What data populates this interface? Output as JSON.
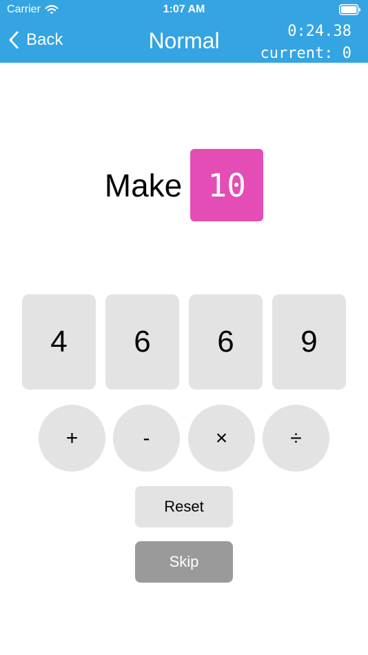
{
  "status_bar": {
    "carrier": "Carrier",
    "time": "1:07 AM"
  },
  "nav": {
    "back_label": "Back",
    "title": "Normal",
    "timer": "0:24.38",
    "current": "current: 0"
  },
  "game": {
    "make_label": "Make",
    "target": "10",
    "cards": [
      "4",
      "6",
      "6",
      "9"
    ],
    "operators": [
      "+",
      "-",
      "×",
      "÷"
    ]
  },
  "actions": {
    "reset_label": "Reset",
    "skip_label": "Skip"
  },
  "colors": {
    "header": "#34a4e3",
    "target": "#e54db6",
    "tile": "#e3e3e3",
    "skip": "#9a9a9a"
  },
  "icons": {
    "signal": "wifi-icon",
    "battery": "battery-icon",
    "back": "chevron-left-icon"
  }
}
